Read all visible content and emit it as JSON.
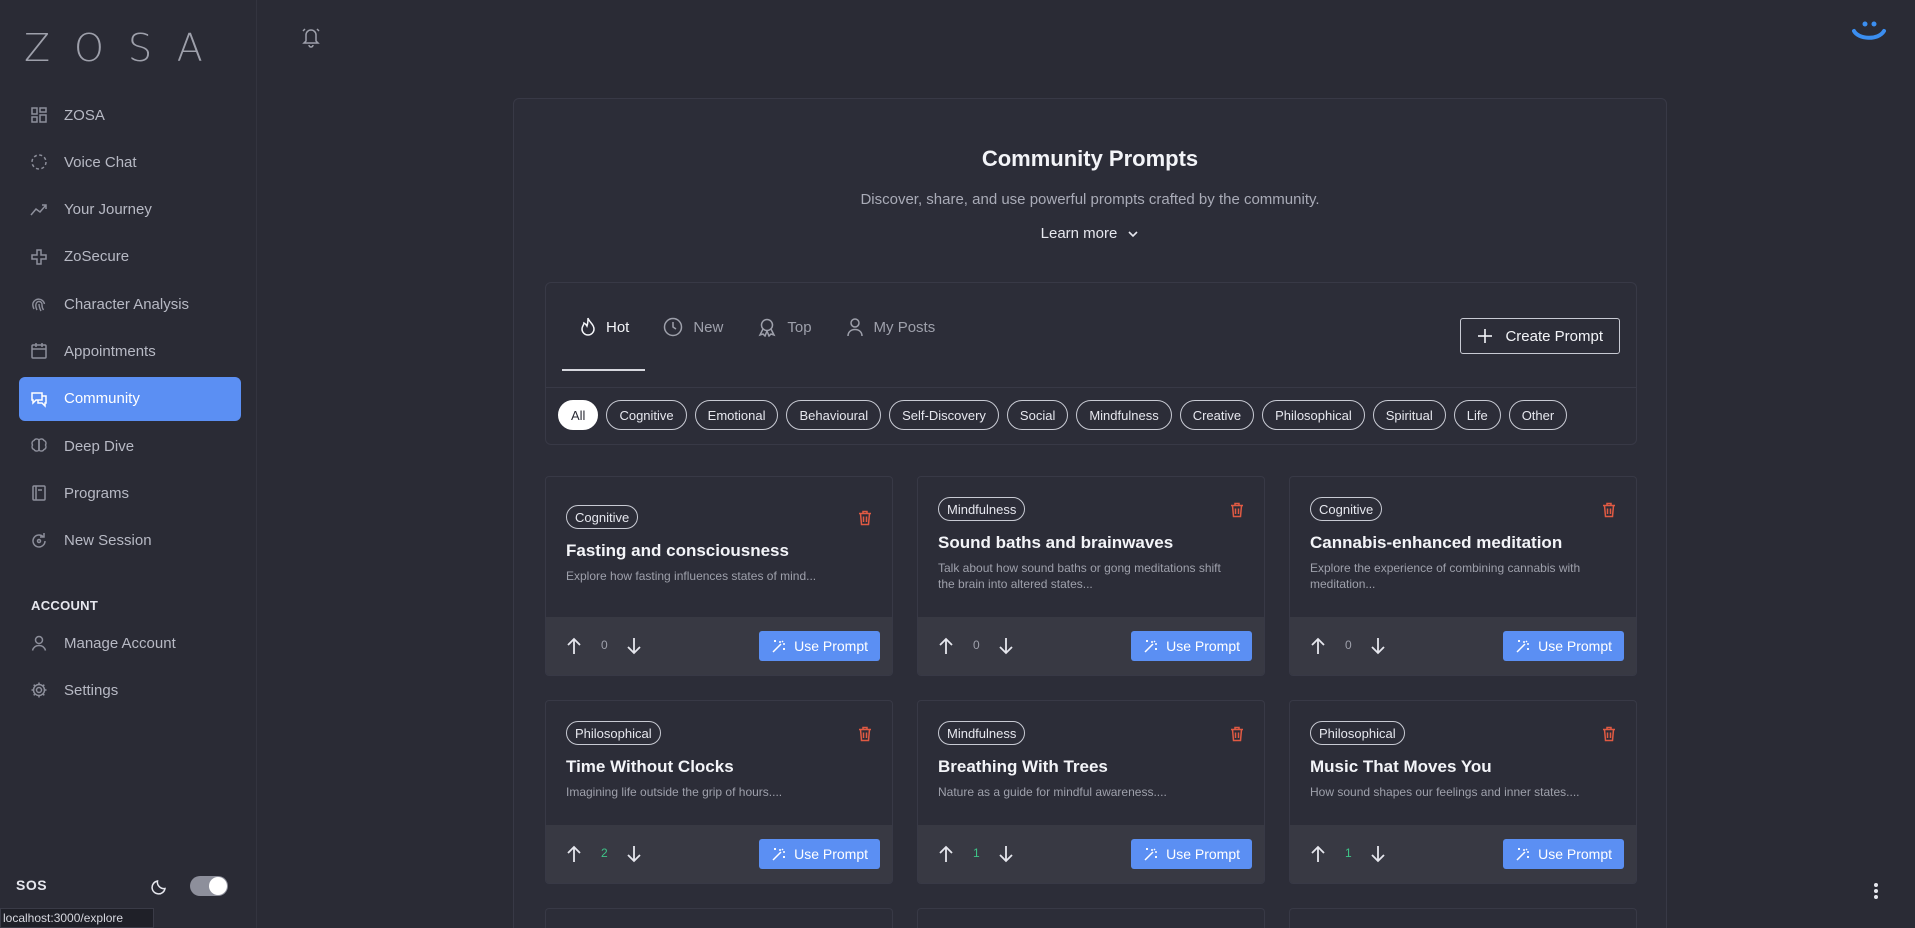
{
  "app": {
    "logo": "ZOSA"
  },
  "sidebar": {
    "items": [
      {
        "label": "ZOSA",
        "icon": "dashboard-icon"
      },
      {
        "label": "Voice Chat",
        "icon": "dashed-circle-icon"
      },
      {
        "label": "Your Journey",
        "icon": "trending-up-icon"
      },
      {
        "label": "ZoSecure",
        "icon": "shield-icon"
      },
      {
        "label": "Character Analysis",
        "icon": "fingerprint-icon"
      },
      {
        "label": "Appointments",
        "icon": "calendar-icon"
      },
      {
        "label": "Community",
        "icon": "chat-bubbles-icon",
        "active": true
      },
      {
        "label": "Deep Dive",
        "icon": "brain-icon"
      },
      {
        "label": "Programs",
        "icon": "book-icon"
      },
      {
        "label": "New Session",
        "icon": "refresh-icon"
      }
    ],
    "account_label": "ACCOUNT",
    "account_items": [
      {
        "label": "Manage Account",
        "icon": "user-icon"
      },
      {
        "label": "Settings",
        "icon": "gear-icon"
      }
    ],
    "sos_label": "SOS",
    "dark_mode_on": true
  },
  "status_url": "localhost:3000/explore",
  "page": {
    "title": "Community Prompts",
    "subtitle": "Discover, share, and use powerful prompts crafted by the community.",
    "learn_more": "Learn more"
  },
  "tabs": [
    {
      "label": "Hot",
      "icon": "flame-icon",
      "active": true
    },
    {
      "label": "New",
      "icon": "clock-icon"
    },
    {
      "label": "Top",
      "icon": "award-icon"
    },
    {
      "label": "My Posts",
      "icon": "user-icon"
    }
  ],
  "create_button": "Create Prompt",
  "categories": [
    "All",
    "Cognitive",
    "Emotional",
    "Behavioural",
    "Self-Discovery",
    "Social",
    "Mindfulness",
    "Creative",
    "Philosophical",
    "Spiritual",
    "Life",
    "Other"
  ],
  "selected_category": "All",
  "use_prompt_label": "Use Prompt",
  "cards": [
    {
      "tag": "Cognitive",
      "title": "Fasting and consciousness",
      "description": "Explore how fasting influences states of mind...",
      "votes": "0"
    },
    {
      "tag": "Mindfulness",
      "title": "Sound baths and brainwaves",
      "description": "Talk about how sound baths or gong meditations shift the brain into altered states...",
      "votes": "0"
    },
    {
      "tag": "Cognitive",
      "title": "Cannabis-enhanced meditation",
      "description": "Explore the experience of combining cannabis with meditation...",
      "votes": "0"
    },
    {
      "tag": "Philosophical",
      "title": "Time Without Clocks",
      "description": "Imagining life outside the grip of hours....",
      "votes": "2"
    },
    {
      "tag": "Mindfulness",
      "title": "Breathing With Trees",
      "description": "Nature as a guide for mindful awareness....",
      "votes": "1"
    },
    {
      "tag": "Philosophical",
      "title": "Music That Moves You",
      "description": "How sound shapes our feelings and inner states....",
      "votes": "1"
    }
  ],
  "colors": {
    "accent": "#5b8ff3",
    "background": "#2a2b35",
    "delete": "#e05a43",
    "positive": "#3ec487"
  }
}
